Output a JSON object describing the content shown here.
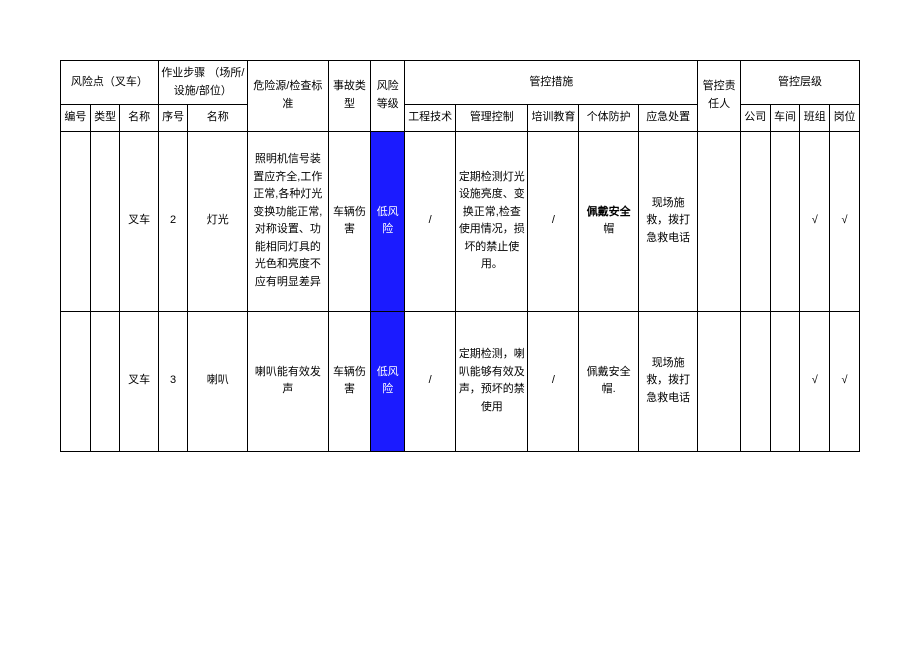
{
  "headers": {
    "risk_point": "风险点（叉车）",
    "work_step": "作业步骤\n（场所/设施/部位）",
    "hazard_check": "危险源/检查标准",
    "accident_type": "事故类型",
    "risk_level": "风险等级",
    "control_measures": "管控措施",
    "responsible": "管控责任人",
    "control_layer": "管控层级",
    "sn": "编号",
    "type": "类型",
    "name": "名称",
    "step_sn": "序号",
    "step_name": "名称",
    "eng": "工程技术",
    "mgmt": "管理控制",
    "train": "培训教育",
    "ppe": "个体防护",
    "emergency": "应急处置",
    "company": "公司",
    "workshop": "车间",
    "team": "班组",
    "post": "岗位"
  },
  "rows": [
    {
      "sn": "",
      "type": "",
      "name": "叉车",
      "step_sn": "2",
      "step_name": "灯光",
      "hazard": "照明机信号装置应齐全,工作正常,各种灯光变换功能正常,对称设置、功能相同灯具的光色和亮度不应有明显差异",
      "accident": "车辆伤害",
      "level": "低风险",
      "eng": "/",
      "mgmt": "定期检测灯光设施亮度、变换正常,检查使用情况，损坏的禁止使用。",
      "train": "/",
      "ppe": "佩戴安全",
      "ppe_suffix": "帽",
      "emergency": "现场施救，拨打急救电话",
      "resp": "",
      "company": "",
      "workshop": "",
      "team": "√",
      "post": "√"
    },
    {
      "sn": "",
      "type": "",
      "name": "叉车",
      "step_sn": "3",
      "step_name": "喇叭",
      "hazard": "喇叭能有效发声",
      "accident": "车辆伤害",
      "level": "低风险",
      "eng": "/",
      "mgmt": "定期检测，喇叭能够有效及声，预坏的禁使用",
      "train": "/",
      "ppe": "佩戴安全帽.",
      "ppe_suffix": "",
      "emergency": "现场施救，拨打急救电话",
      "resp": "",
      "company": "",
      "workshop": "",
      "team": "√",
      "post": "√"
    }
  ]
}
